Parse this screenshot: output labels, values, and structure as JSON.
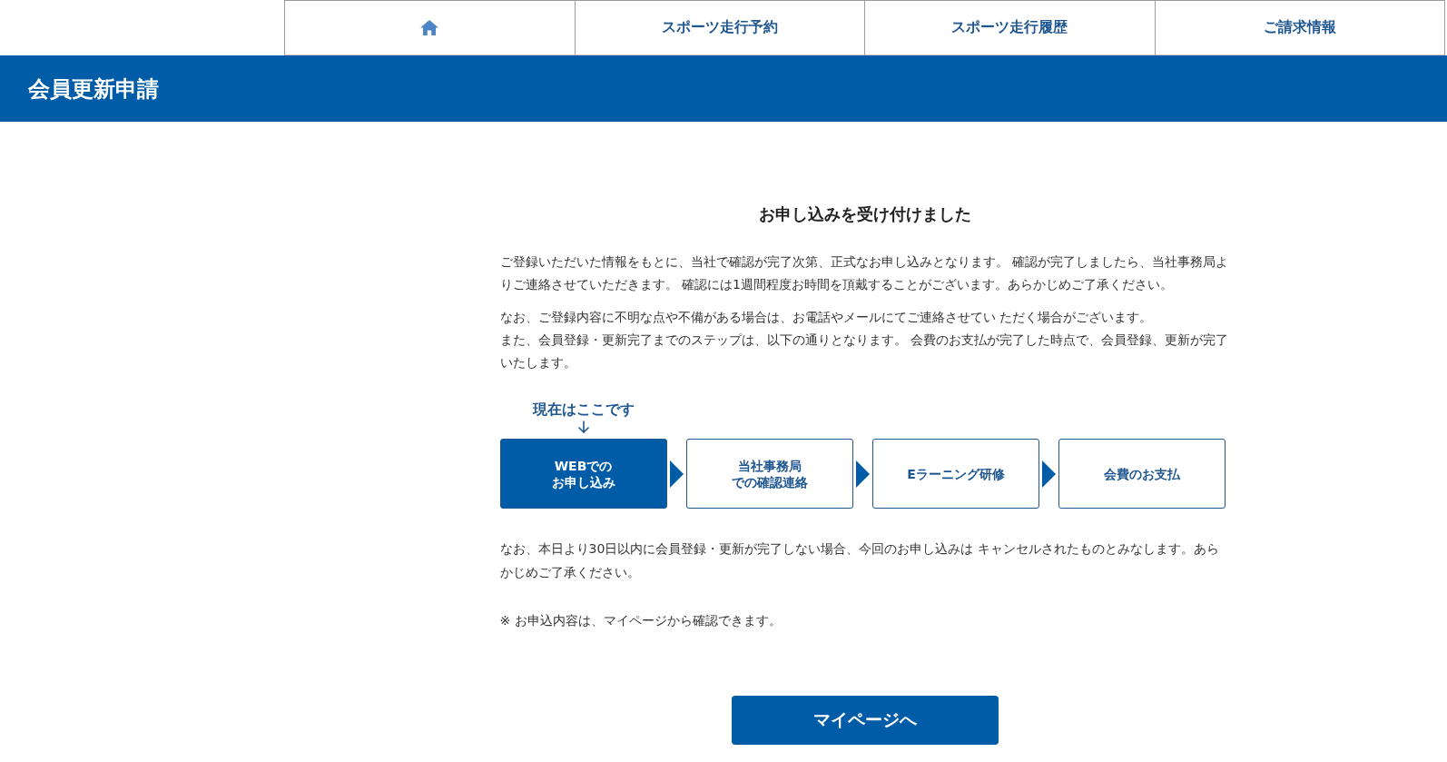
{
  "nav": {
    "items": [
      {
        "kind": "home"
      },
      {
        "kind": "link",
        "label": "スポーツ走行予約"
      },
      {
        "kind": "link",
        "label": "スポーツ走行履歴"
      },
      {
        "kind": "link",
        "label": "ご請求情報"
      }
    ]
  },
  "page_header": {
    "title": "会員更新申請"
  },
  "confirmation": {
    "heading": "お申し込みを受け付けました",
    "intro": [
      [
        "ご登録いただいた情報をもとに、当社で確認が完了次第、正式なお申し込みとなります。 確認が完了しましたら、当社事務局よりご連絡させていただきます。 確認には1週間程度お時間を頂戴することがございます。あらかじめご了承ください。"
      ],
      [
        "なお、ご登録内容に不明な点や不備がある場合は、お電話やメールにてご連絡させてい ただく場合がございます。",
        "また、会員登録・更新完了までのステップは、以下の通りとなります。 会費のお支払が完了した時点で、会員登録、更新が完了いたします。"
      ]
    ],
    "current_marker": "現在はここです",
    "steps": [
      {
        "lines": [
          "WEBでの",
          "お申し込み"
        ],
        "selected": true
      },
      {
        "lines": [
          "当社事務局",
          "での確認連絡"
        ],
        "selected": false
      },
      {
        "lines": [
          "Eラーニング研修"
        ],
        "selected": false
      },
      {
        "lines": [
          "会費のお支払"
        ],
        "selected": false
      }
    ],
    "notes": [
      "なお、本日より30日以内に会員登録・更新が完了しない場合、今回のお申し込みは キャンセルされたものとみなします。あらかじめご了承ください。",
      "※ お申込内容は、マイページから確認できます。"
    ]
  },
  "mypage_button": {
    "label": "マイページへ"
  }
}
